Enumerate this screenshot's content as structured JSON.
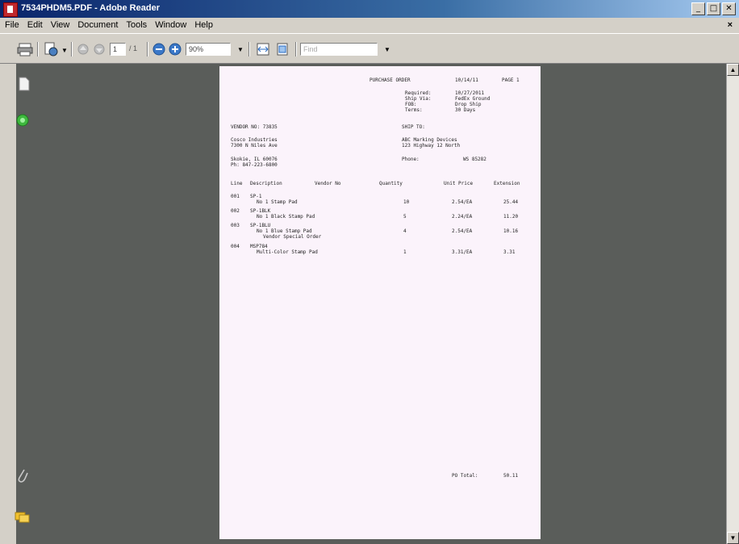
{
  "window": {
    "title": "7534PHDM5.PDF - Adobe Reader"
  },
  "titlebar_buttons": [
    "_",
    "□",
    "✕"
  ],
  "menu": {
    "items": [
      "File",
      "Edit",
      "View",
      "Document",
      "Tools",
      "Window",
      "Help"
    ],
    "doc_close": "×"
  },
  "toolbar": {
    "page_current": "1",
    "page_total": "/ 1",
    "zoom": "90%",
    "find_placeholder": "Find"
  },
  "document": {
    "header": {
      "title": "PURCHASE ORDER",
      "date": "10/14/11",
      "page": "PAGE 1"
    },
    "ship_info": [
      {
        "label": "Required:",
        "value": "10/27/2011"
      },
      {
        "label": "Ship Via:",
        "value": "FedEx Ground"
      },
      {
        "label": "FOB:",
        "value": "Drop Ship"
      },
      {
        "label": "Terms:",
        "value": "30 Days"
      }
    ],
    "vendor_label": "VENDOR NO: 73835",
    "vendor_name": "Cosco Industries",
    "vendor_address": [
      "7300 N Niles Ave",
      "Skokie, IL 60076",
      "Ph: 847-223-6800"
    ],
    "ship_to_label": "SHIP TO:",
    "ship_to_name": "ABC Marking Devices",
    "ship_to_address": "123 Highway 12 North",
    "phone_label": "Phone:",
    "phone_value": "WS 85282",
    "columns": {
      "line": "Line",
      "description": "Description",
      "vendor_no": "Vendor No",
      "quantity": "Quantity",
      "unit_price": "Unit Price",
      "extension": "Extension"
    },
    "lines": [
      {
        "line": "001",
        "code": "SP-1",
        "desc": "No 1 Stamp Pad",
        "qty": "10",
        "price": "2.54/EA",
        "ext": "25.44"
      },
      {
        "line": "002",
        "code": "SP-1BLK",
        "desc": "No 1 Black Stamp Pad",
        "qty": "5",
        "price": "2.24/EA",
        "ext": "11.20"
      },
      {
        "line": "003",
        "code": "SP-1BLU",
        "desc": "No 1 Blue Stamp Pad",
        "note": "Vendor Special Order",
        "qty": "4",
        "price": "2.54/EA",
        "ext": "10.16"
      },
      {
        "line": "004",
        "code": "MSP784",
        "desc": "Multi-Color Stamp Pad",
        "qty": "1",
        "price": "3.31/EA",
        "ext": "3.31"
      }
    ],
    "total_label": "PO Total:",
    "total_value": "50.11"
  }
}
